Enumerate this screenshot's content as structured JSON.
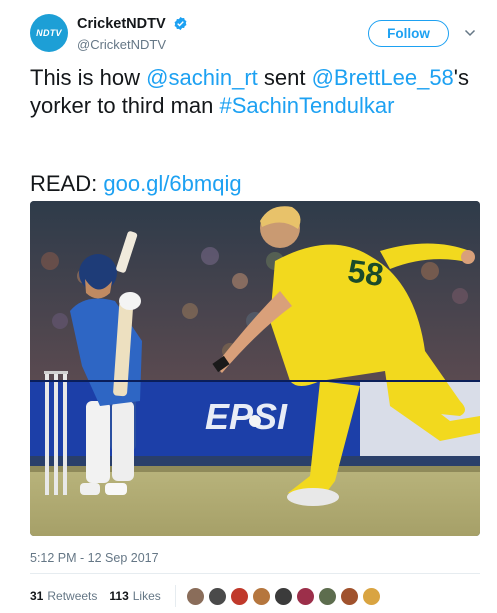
{
  "account": {
    "display_name": "CricketNDTV",
    "handle": "@CricketNDTV",
    "logo_text": "NDTV",
    "verified_icon": "verified-badge-icon",
    "brand_color": "#1d9fd6"
  },
  "follow_label": "Follow",
  "menu_icon": "chevron-down-icon",
  "tweet": {
    "part1": "This is how ",
    "mention1": "@sachin_rt",
    "part2": " sent ",
    "mention2": "@BrettLee_58",
    "part3": "'s yorker to third man ",
    "hashtag": "#SachinTendulkar",
    "read_label": "READ: ",
    "link": "goo.gl/6bmqig"
  },
  "photo": {
    "jersey_number": "58",
    "board_text": "EPSI"
  },
  "timestamp": "5:12 PM - 12 Sep 2017",
  "stats": {
    "retweets_count": "31",
    "retweets_label": "Retweets",
    "likes_count": "113",
    "likes_label": "Likes"
  },
  "likers_colors": [
    "#8a6d5a",
    "#4a4a4a",
    "#c0392b",
    "#b5763e",
    "#3b3b3b",
    "#9c2f4a",
    "#5d6d4e",
    "#a0522d",
    "#d9a441"
  ],
  "link_color": "#1da1f2"
}
